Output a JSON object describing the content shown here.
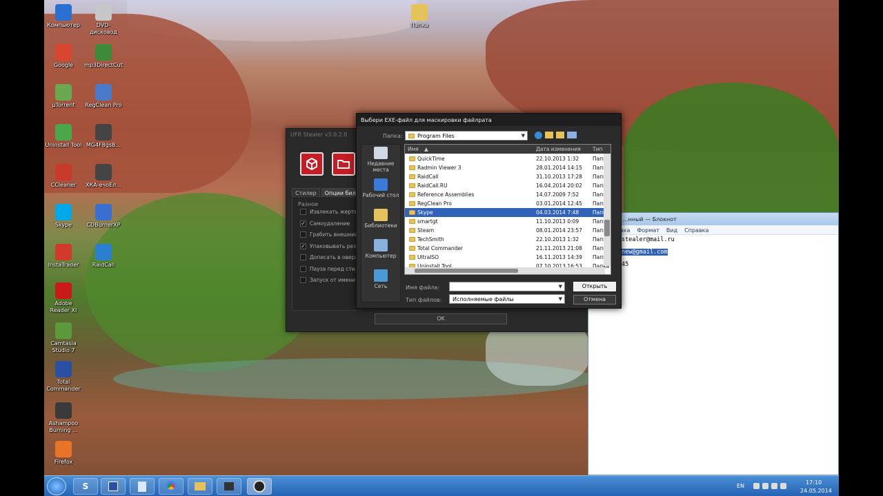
{
  "desktop": {
    "icons": [
      {
        "label": "Компьютер",
        "icon": "computer-icon",
        "color": "#2b6fd1"
      },
      {
        "label": "DVD-дисковод",
        "icon": "dvd-drive-icon",
        "color": "#c7c7c7"
      },
      {
        "label": "Google",
        "icon": "chrome-icon",
        "color": "#d9452e"
      },
      {
        "label": "mp3DirectCut",
        "icon": "mp3-icon",
        "color": "#3a8a3a"
      },
      {
        "label": "µTorrent",
        "icon": "utorrent-icon",
        "color": "#6aa84f"
      },
      {
        "label": "RegClean Pro",
        "icon": "regclean-icon",
        "color": "#4a7ac9"
      },
      {
        "label": "Uninstall Tool",
        "icon": "uninstall-icon",
        "color": "#4aa84a"
      },
      {
        "label": "MG4F8gsB...",
        "icon": "video-file-icon",
        "color": "#444444"
      },
      {
        "label": "CCleaner",
        "icon": "ccleaner-icon",
        "color": "#c93a2a"
      },
      {
        "label": "ХКА-ечоЕл...",
        "icon": "video-file-icon",
        "color": "#444444"
      },
      {
        "label": "Skype",
        "icon": "skype-icon",
        "color": "#00a8e8"
      },
      {
        "label": "CDBurnerXP",
        "icon": "cdburner-icon",
        "color": "#3a6fd1"
      },
      {
        "label": "InstaTrader",
        "icon": "instatrader-icon",
        "color": "#d13a2a"
      },
      {
        "label": "RaidCall",
        "icon": "raidcall-icon",
        "color": "#2b7fd1"
      },
      {
        "label": "Adobe Reader XI",
        "icon": "adobe-reader-icon",
        "color": "#c91a1a"
      },
      {
        "label": "Camtasia Studio 7",
        "icon": "camtasia-icon",
        "color": "#5a9a3a"
      },
      {
        "label": "Total Commander",
        "icon": "total-commander-icon",
        "color": "#2b4fa1"
      },
      {
        "label": "Ashampoo Burning ...",
        "icon": "ashampoo-icon",
        "color": "#3a3a3a"
      },
      {
        "label": "Firefox",
        "icon": "firefox-icon",
        "color": "#e8742a"
      },
      {
        "label": "Папка",
        "icon": "folder-icon",
        "color": "#e6c35a"
      }
    ]
  },
  "stealer": {
    "title": "UFR Stealer v3.0.2.0",
    "tabs": [
      "Стилер",
      "Опции билда"
    ],
    "group": "Разное",
    "options": [
      {
        "label": "Извлекать жертве",
        "checked": false
      },
      {
        "label": "Самоудаление",
        "checked": true
      },
      {
        "label": "Грабить внешний",
        "checked": false
      },
      {
        "label": "Упаковывать резу",
        "checked": true
      },
      {
        "label": "Дописать в оверле",
        "checked": false
      },
      {
        "label": "Пауза перед стили",
        "checked": false
      },
      {
        "label": "Запуск от имени ад",
        "checked": false
      }
    ],
    "check_mark": "✓",
    "ok_label": "OK"
  },
  "notepad": {
    "title": "...нный — Блокнот",
    "menu": [
      "вка",
      "Формат",
      "Вид",
      "Справка"
    ],
    "lines": [
      "stealer@mail.ru",
      "new@gmail.com",
      "45"
    ]
  },
  "dialog": {
    "title": "Выбери EXE-файл для маскировки файлрата",
    "folder_label": "Папка:",
    "folder_value": "Program Files",
    "places": [
      "Недавние места",
      "Рабочий стол",
      "Библиотеки",
      "Компьютер",
      "Сеть"
    ],
    "columns": {
      "name": "Имя",
      "date": "Дата изменения",
      "type": "Тип"
    },
    "rows": [
      {
        "name": "QuickTime",
        "date": "22.10.2013 1:32",
        "type": "Папка",
        "selected": false
      },
      {
        "name": "Radmin Viewer 3",
        "date": "28.01.2014 14:15",
        "type": "Папка",
        "selected": false
      },
      {
        "name": "RaidCall",
        "date": "31.10.2013 17:28",
        "type": "Папка",
        "selected": false
      },
      {
        "name": "RaidCall.RU",
        "date": "16.04.2014 20:02",
        "type": "Папка",
        "selected": false
      },
      {
        "name": "Reference Assemblies",
        "date": "14.07.2009 7:52",
        "type": "Папка",
        "selected": false
      },
      {
        "name": "RegClean Pro",
        "date": "03.01.2014 12:45",
        "type": "Папка",
        "selected": false
      },
      {
        "name": "Skype",
        "date": "04.03.2014 7:48",
        "type": "Папка",
        "selected": true
      },
      {
        "name": "smartgt",
        "date": "11.10.2013 0:09",
        "type": "Папка",
        "selected": false
      },
      {
        "name": "Steam",
        "date": "08.01.2014 23:57",
        "type": "Папка",
        "selected": false
      },
      {
        "name": "TechSmith",
        "date": "22.10.2013 1:32",
        "type": "Папка",
        "selected": false
      },
      {
        "name": "Total Commander",
        "date": "21.11.2013 21:08",
        "type": "Папка",
        "selected": false
      },
      {
        "name": "UltraISO",
        "date": "16.11.2013 14:39",
        "type": "Папка",
        "selected": false
      },
      {
        "name": "Uninstall Tool",
        "date": "07.10.2013 16:53",
        "type": "Папка",
        "selected": false
      }
    ],
    "filename_label": "Имя файла:",
    "filename_value": "",
    "filetype_label": "Тип файлов:",
    "filetype_value": "Исполняемые файлы",
    "open_label": "Открыть",
    "cancel_label": "Отмена"
  },
  "taskbar": {
    "language": "EN",
    "time": "17:10",
    "date": "24.05.2014"
  }
}
